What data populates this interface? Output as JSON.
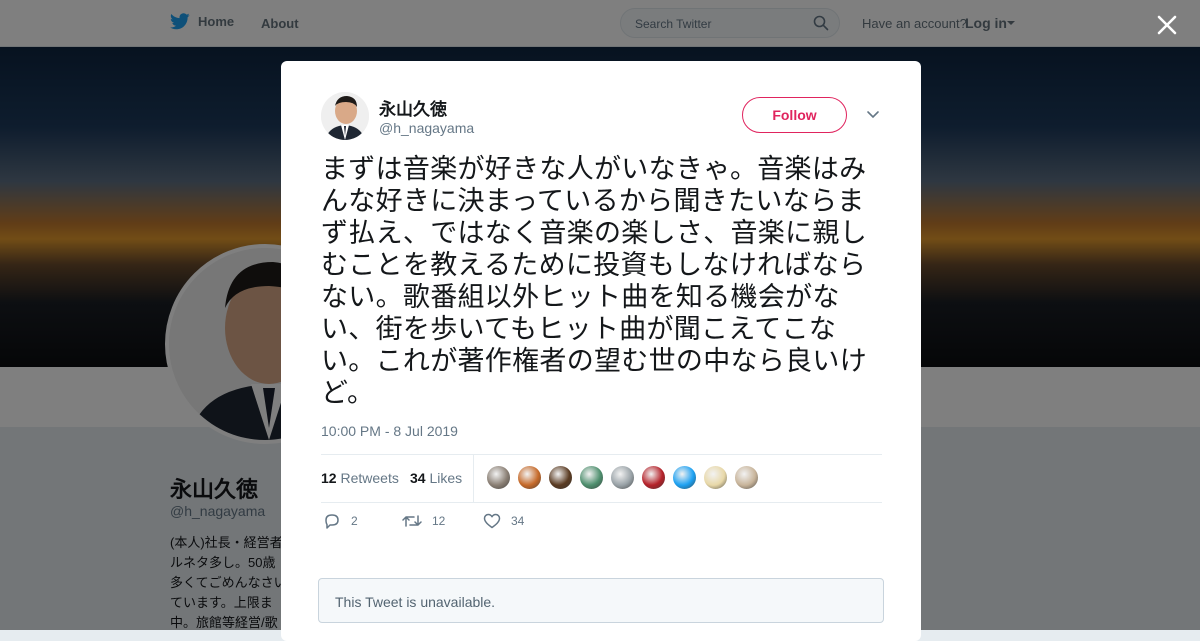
{
  "nav": {
    "home_label": "Home",
    "about_label": "About",
    "search_placeholder": "Search Twitter",
    "have_account": "Have an account?",
    "login_label": "Log in"
  },
  "profile": {
    "name": "永山久徳",
    "handle": "@h_nagayama",
    "bio_lines": [
      "(本人)社長・経営者",
      "ルネタ多し。50歳",
      "多くてごめんなさい",
      "ています。上限ま",
      "中。旅館等経営/歌"
    ]
  },
  "tweet": {
    "author_name": "永山久徳",
    "author_handle": "@h_nagayama",
    "follow_label": "Follow",
    "text": "まずは音楽が好きな人がいなきゃ。音楽はみんな好きに決まっているから聞きたいならまず払え、ではなく音楽の楽しさ、音楽に親しむことを教えるために投資もしなければならない。歌番組以外ヒット曲を知る機会がない、街を歩いてもヒット曲が聞こえてこない。これが著作権者の望む世の中なら良いけど。",
    "time": "10:00 PM - 8 Jul 2019",
    "retweets_count": "12",
    "retweets_label": "Retweets",
    "likes_count": "34",
    "likes_label": "Likes",
    "reply_count": "2",
    "retweet_action_count": "12",
    "like_action_count": "34",
    "liker_colors": [
      "#8a7f74",
      "#c66a2a",
      "#5a3b22",
      "#4e8f6e",
      "#9aa3a8",
      "#b5222a",
      "#1da1f2",
      "#e8d8a8",
      "#c8b49a"
    ]
  },
  "embedded": {
    "unavailable_text": "This Tweet is unavailable."
  },
  "colors": {
    "twitter_blue": "#1da1f2",
    "follow_red": "#e0245e",
    "secondary_text": "#657786"
  }
}
